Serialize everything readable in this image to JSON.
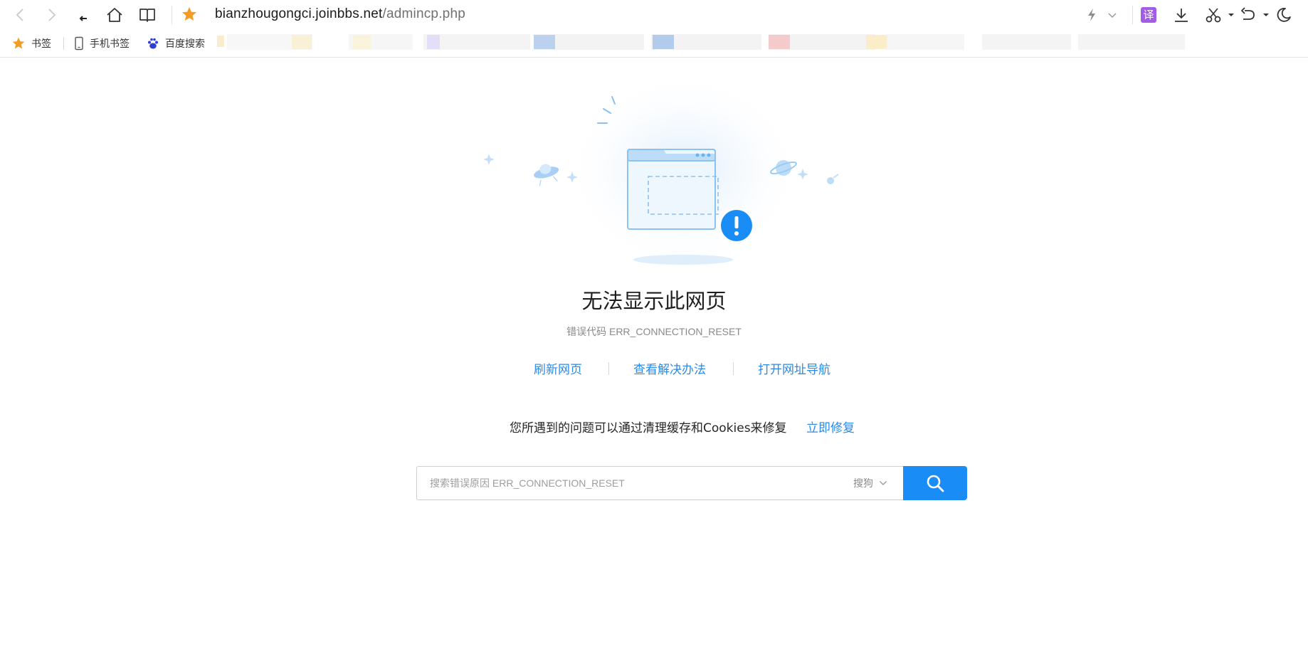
{
  "browser": {
    "url_host": "bianzhougongci.joinbbs.net",
    "url_path": "/admincp.php",
    "translate_label": "译",
    "icons": [
      "back-icon",
      "forward-icon",
      "reload-icon",
      "home-icon",
      "reading-book-icon",
      "favorite-star-icon",
      "flash-icon",
      "chevron-down-icon",
      "translate-icon",
      "download-icon",
      "scissors-icon",
      "undo-icon",
      "night-mode-moon-icon"
    ]
  },
  "bookmarks": {
    "items": [
      {
        "label": "书签",
        "icon": "star-icon"
      },
      {
        "label": "手机书签",
        "icon": "phone-icon"
      },
      {
        "label": "百度搜索",
        "icon": "baidu-paw-icon"
      }
    ]
  },
  "error": {
    "title": "无法显示此网页",
    "code": "错误代码 ERR_CONNECTION_RESET",
    "actions": [
      "刷新网页",
      "查看解决办法",
      "打开网址导航"
    ],
    "fix_text": "您所遇到的问题可以通过清理缓存和Cookies来修复",
    "fix_link": "立即修复"
  },
  "search": {
    "placeholder": "搜索错误原因 ERR_CONNECTION_RESET",
    "engine": "搜狗"
  },
  "colors": {
    "accent": "#1a8cf5",
    "link": "#2b8ae8",
    "star": "#f59a23",
    "translate_bg": "#a35ce8"
  }
}
